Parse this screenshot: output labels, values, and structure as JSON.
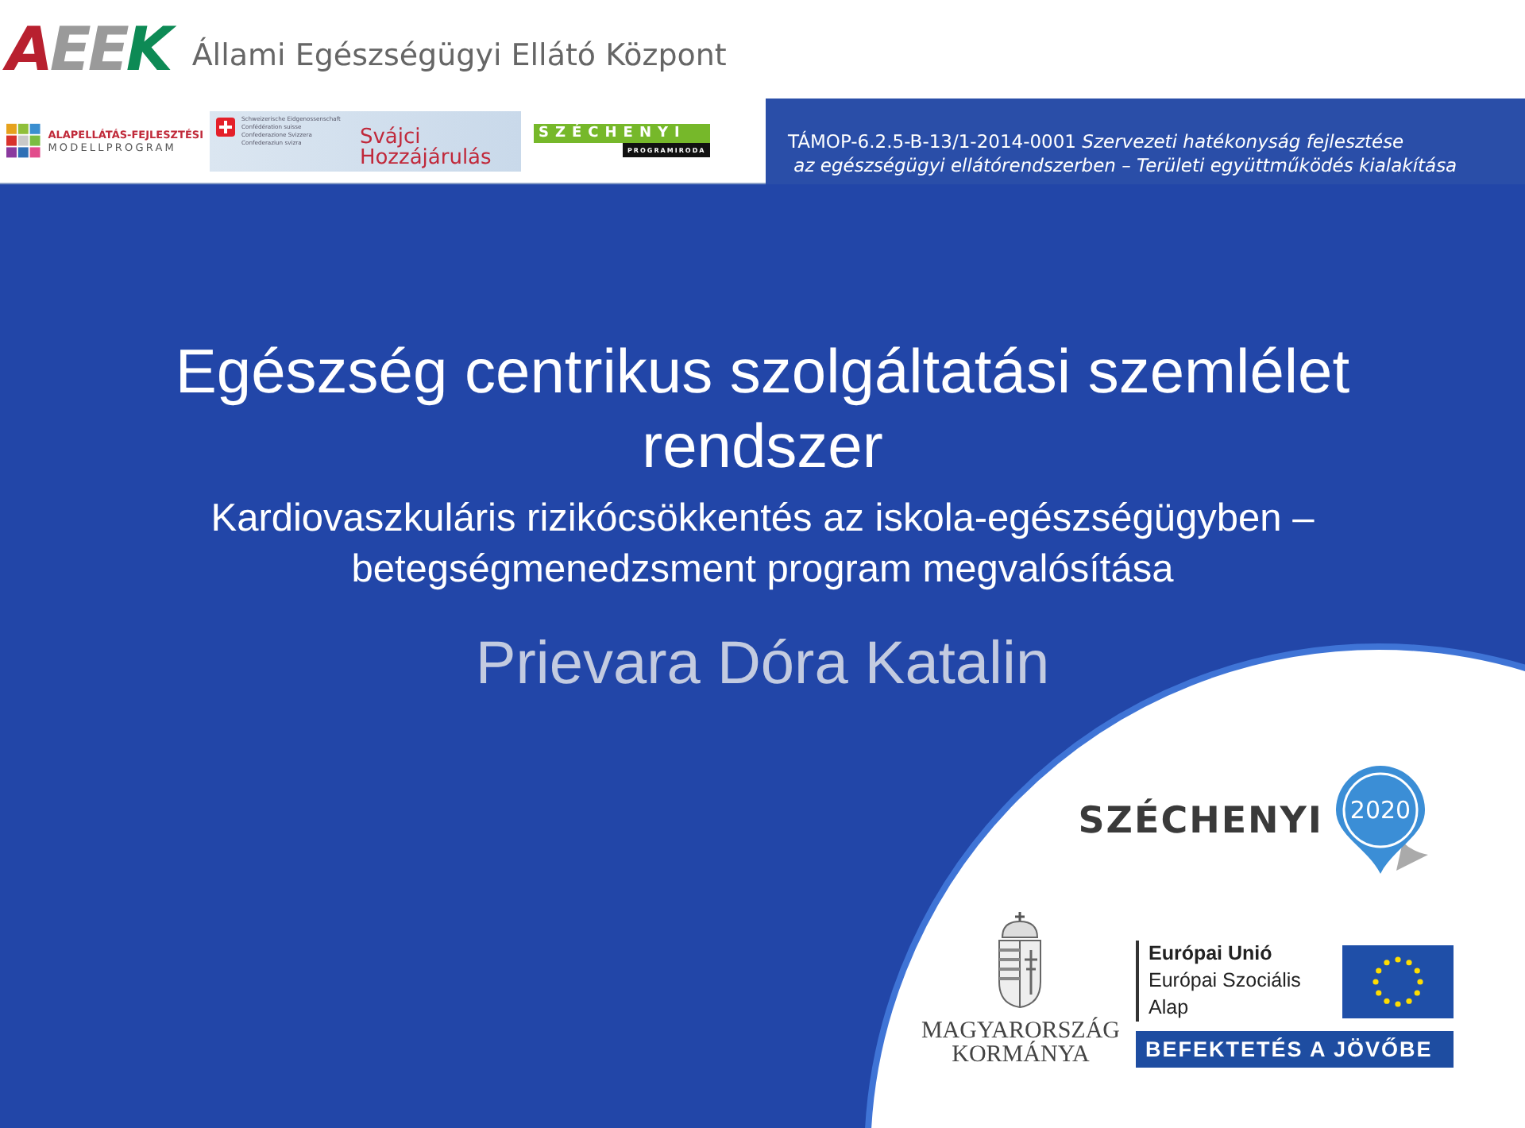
{
  "header": {
    "logo_text": "AEEK",
    "org_name": "Állami Egészségügyi Ellátó Központ"
  },
  "partner_logos": {
    "alapellatas": {
      "line_1": "ALAPELLÁTÁS-FEJLESZTÉSI",
      "line_2": "MODELLPROGRAM"
    },
    "swiss": {
      "small_lines": [
        "Schweizerische Eidgenossenschaft",
        "Confédération suisse",
        "Confederazione Svizzera",
        "Confederaziun svizra"
      ],
      "title_1": "Svájci",
      "title_2": "Hozzájárulás"
    },
    "szechenyi": {
      "title": "SZÉCHENYI",
      "subtitle": "PROGRAMIRODA"
    }
  },
  "project": {
    "code": "TÁMOP-6.2.5-B-13/1-2014-0001",
    "title_1": "Szervezeti hatékonyság fejlesztése",
    "title_2": "az egészségügyi ellátórendszerben – Területi együttműködés kialakítása"
  },
  "slide": {
    "title": "Egészség centrikus szolgáltatási szemlélet rendszer",
    "subtitle": "Kardiovaszkuláris rizikócsökkentés az iskola-egészségügyben – betegségmenedzsment program megvalósítása",
    "author": "Prievara Dóra Katalin"
  },
  "footer": {
    "szechenyi_2020": {
      "name": "SZÉCHENYI",
      "year": "2020"
    },
    "government": {
      "line_1": "MAGYARORSZÁG",
      "line_2": "KORMÁNYA"
    },
    "eu": {
      "name": "Európai Unió",
      "fund": "Európai Szociális Alap",
      "slogan": "BEFEKTETÉS A JÖVŐBE"
    }
  }
}
